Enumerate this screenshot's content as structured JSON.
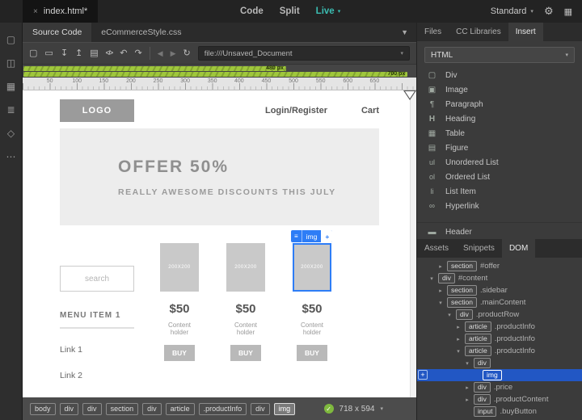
{
  "icons": {
    "close": "×",
    "caret_down": "▾",
    "gear": "⚙",
    "grid": "▦",
    "filter": "▼",
    "back": "◀",
    "forward": "▶",
    "refresh": "↻",
    "check": "✓",
    "menu": "≡",
    "plus": "+"
  },
  "colors": {
    "accent_green": "#9fc73c",
    "live_teal": "#3bbdb2",
    "selection_blue": "#2e7df6",
    "dom_selected_blue": "#2257c4"
  },
  "topbar": {
    "tab_title": "index.html*",
    "modes": [
      {
        "label": "Code"
      },
      {
        "label": "Split"
      },
      {
        "label": "Live"
      }
    ],
    "workspace": "Standard"
  },
  "leftbar_icons": [
    {
      "name": "file-icon",
      "glyph": "▢"
    },
    {
      "name": "panels-icon",
      "glyph": "◫"
    },
    {
      "name": "devices-icon",
      "glyph": "▦"
    },
    {
      "name": "list-view-icon",
      "glyph": "≣"
    },
    {
      "name": "tag-icon",
      "glyph": "◇"
    },
    {
      "name": "more-options-icon",
      "glyph": "⋯"
    }
  ],
  "docbar": {
    "tabs": [
      "Source Code",
      "eCommerceStyle.css"
    ],
    "address": "file:///Unsaved_Document"
  },
  "toolbar_icons": [
    {
      "name": "new-file-icon",
      "glyph": "▢"
    },
    {
      "name": "open-file-icon",
      "glyph": "▭"
    },
    {
      "name": "get-file-icon",
      "glyph": "↧"
    },
    {
      "name": "put-file-icon",
      "glyph": "↥"
    },
    {
      "name": "preview-icon",
      "glyph": "▤"
    },
    {
      "name": "code-tools-icon",
      "glyph": "</>"
    },
    {
      "name": "undo-icon",
      "glyph": "↶"
    },
    {
      "name": "redo-icon",
      "glyph": "↷"
    }
  ],
  "vmq": {
    "labels": [
      "480 px",
      "700 px"
    ]
  },
  "ruler": {
    "ticks": [
      "50",
      "100",
      "150",
      "200",
      "250",
      "300",
      "350",
      "400",
      "450",
      "500",
      "550",
      "600",
      "650"
    ]
  },
  "preview": {
    "logo": "LOGO",
    "nav": [
      "Login/Register",
      "Cart"
    ],
    "hero_title": "OFFER 50%",
    "hero_subtitle": "REALLY AWESOME DISCOUNTS THIS JULY",
    "sidebar": {
      "search_placeholder": "search",
      "menu_title": "MENU ITEM 1",
      "links": [
        "Link 1",
        "Link 2"
      ]
    },
    "products": [
      {
        "image_label": "200X200",
        "price": "$50",
        "description": "Content holder",
        "buy_label": "BUY"
      },
      {
        "image_label": "200X200",
        "price": "$50",
        "description": "Content holder",
        "buy_label": "BUY"
      },
      {
        "image_label": "200X200",
        "price": "$50",
        "description": "Content holder",
        "buy_label": "BUY"
      }
    ],
    "element_display": {
      "tag_label": "img"
    }
  },
  "statusbar": {
    "tags": [
      "body",
      "div",
      "div",
      "section",
      "div",
      "article",
      ".productInfo",
      "div",
      "img"
    ],
    "selected_tag": "img",
    "dimensions": "718 x 594"
  },
  "right_panel": {
    "tabs": [
      "Files",
      "CC Libraries",
      "Insert"
    ],
    "active_tab": "Insert",
    "category": "HTML",
    "insert_items": [
      {
        "icon": "div-icon",
        "glyph": "▢",
        "label": "Div"
      },
      {
        "icon": "image-icon",
        "glyph": "▣",
        "label": "Image"
      },
      {
        "icon": "paragraph-icon",
        "glyph": "¶",
        "label": "Paragraph"
      },
      {
        "icon": "heading-icon",
        "glyph": "H",
        "label": "Heading"
      },
      {
        "icon": "table-icon",
        "glyph": "▦",
        "label": "Table"
      },
      {
        "icon": "figure-icon",
        "glyph": "▤",
        "label": "Figure"
      },
      {
        "icon": "unordered-list-icon",
        "glyph": "ul",
        "label": "Unordered List"
      },
      {
        "icon": "ordered-list-icon",
        "glyph": "ol",
        "label": "Ordered List"
      },
      {
        "icon": "list-item-icon",
        "glyph": "li",
        "label": "List Item"
      },
      {
        "icon": "hyperlink-icon",
        "glyph": "∞",
        "label": "Hyperlink"
      },
      {
        "icon": "header-icon",
        "glyph": "▬",
        "label": "Header"
      }
    ],
    "panel_tabs": [
      "Assets",
      "Snippets",
      "DOM"
    ],
    "active_panel_tab": "DOM",
    "dom_rows": [
      {
        "arrow": "▸",
        "tag": "section",
        "label": "#offer"
      },
      {
        "arrow": "▾",
        "tag": "div",
        "label": "#content"
      },
      {
        "arrow": "▸",
        "tag": "section",
        "label": ".sidebar"
      },
      {
        "arrow": "▾",
        "tag": "section",
        "label": ".mainContent"
      },
      {
        "arrow": "▾",
        "tag": "div",
        "label": ".productRow"
      },
      {
        "arrow": "▸",
        "tag": "article",
        "label": ".productInfo"
      },
      {
        "arrow": "▸",
        "tag": "article",
        "label": ".productInfo"
      },
      {
        "arrow": "▾",
        "tag": "article",
        "label": ".productInfo"
      },
      {
        "arrow": "▾",
        "tag": "div",
        "label": ""
      },
      {
        "arrow": "",
        "tag": "img",
        "label": ""
      },
      {
        "arrow": "▸",
        "tag": "div",
        "label": ".price"
      },
      {
        "arrow": "▸",
        "tag": "div",
        "label": ".productContent"
      },
      {
        "arrow": "",
        "tag": "input",
        "label": ".buyButton"
      }
    ]
  }
}
